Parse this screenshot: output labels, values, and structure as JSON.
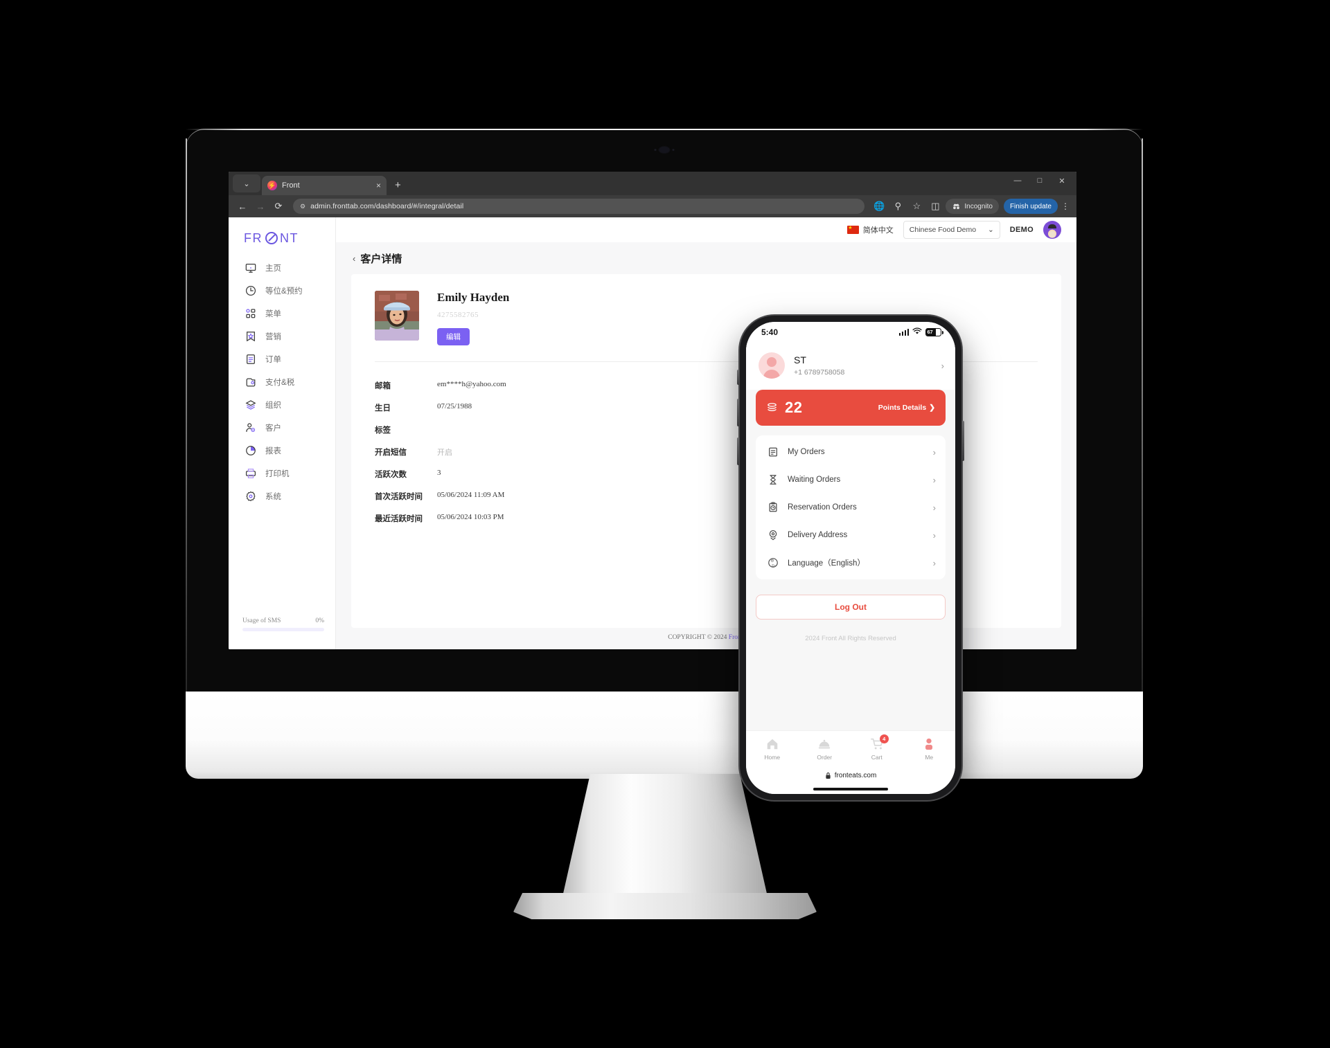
{
  "browser": {
    "tab_title": "Front",
    "url": "admin.fronttab.com/dashboard/#/integral/detail",
    "new_tab_label": "+",
    "close_tab_label": "×",
    "tab_search_label": "⌄",
    "back_label": "←",
    "forward_label": "→",
    "reload_label": "⟳",
    "translate_label": "☰",
    "zoom_label": "⚲",
    "bookmark_label": "☆",
    "sidepanel_label": "◫",
    "incognito_label": "Incognito",
    "update_label": "Finish update",
    "menu_label": "⋮",
    "minimize_label": "—",
    "maximize_label": "□",
    "close_label": "✕"
  },
  "sidebar": {
    "brand": "FRONT",
    "items": [
      {
        "label": "主页",
        "icon": "monitor-icon"
      },
      {
        "label": "等位&预约",
        "icon": "clock-icon"
      },
      {
        "label": "菜单",
        "icon": "grid-icon"
      },
      {
        "label": "营销",
        "icon": "star-badge-icon"
      },
      {
        "label": "订单",
        "icon": "document-icon"
      },
      {
        "label": "支付&税",
        "icon": "wallet-icon"
      },
      {
        "label": "组织",
        "icon": "layers-icon"
      },
      {
        "label": "客户",
        "icon": "user-gear-icon"
      },
      {
        "label": "报表",
        "icon": "pie-chart-icon"
      },
      {
        "label": "打印机",
        "icon": "printer-icon"
      },
      {
        "label": "系统",
        "icon": "settings-gear-icon"
      }
    ],
    "sms_label": "Usage of SMS",
    "sms_percent": "0%"
  },
  "topbar": {
    "language": "简体中文",
    "store": "Chinese Food Demo",
    "store_chevron": "⌄",
    "user": "DEMO"
  },
  "page": {
    "back_chevron": "‹",
    "title": "客户详情"
  },
  "profile": {
    "name": "Emily Hayden",
    "id": "4275582765",
    "edit_label": "编辑"
  },
  "fields": [
    {
      "label": "邮箱",
      "value": "em****h@yahoo.com",
      "muted": false
    },
    {
      "label": "生日",
      "value": "07/25/1988",
      "muted": false
    },
    {
      "label": "标签",
      "value": "",
      "muted": false
    },
    {
      "label": "开启短信",
      "value": "开启",
      "muted": true
    },
    {
      "label": "活跃次数",
      "value": "3",
      "muted": false
    },
    {
      "label": "首次活跃时间",
      "value": "05/06/2024 11:09 AM",
      "muted": false
    },
    {
      "label": "最近活跃时间",
      "value": "05/06/2024 10:03 PM",
      "muted": false
    }
  ],
  "footer": {
    "copyright": "COPYRIGHT © 2024",
    "link": "Front."
  },
  "phone": {
    "status": {
      "time": "5:40",
      "battery_percent": "67",
      "battery_level": 67
    },
    "user": {
      "name": "ST",
      "phone": "+1 6789758058",
      "chevron": "›"
    },
    "points": {
      "value": "22",
      "link_label": "Points Details",
      "chevron": "❯",
      "color": "#e84c3f"
    },
    "menu": [
      {
        "label": "My Orders",
        "icon": "orders-document-icon",
        "chevron": "›"
      },
      {
        "label": "Waiting Orders",
        "icon": "hourglass-icon",
        "chevron": "›"
      },
      {
        "label": "Reservation Orders",
        "icon": "clipboard-clock-icon",
        "chevron": "›"
      },
      {
        "label": "Delivery Address",
        "icon": "location-pin-icon",
        "chevron": "›"
      },
      {
        "label": "Language（English）",
        "icon": "language-icon",
        "chevron": "›"
      }
    ],
    "logout_label": "Log Out",
    "footer": "2024 Front All Rights Reserved",
    "tabs": [
      {
        "label": "Home",
        "icon": "home-icon",
        "badge": ""
      },
      {
        "label": "Order",
        "icon": "dish-cover-icon",
        "badge": ""
      },
      {
        "label": "Cart",
        "icon": "cart-icon",
        "badge": "4"
      },
      {
        "label": "Me",
        "icon": "person-icon",
        "badge": ""
      }
    ],
    "url": "fronteats.com",
    "lock_icon": "🔒"
  }
}
